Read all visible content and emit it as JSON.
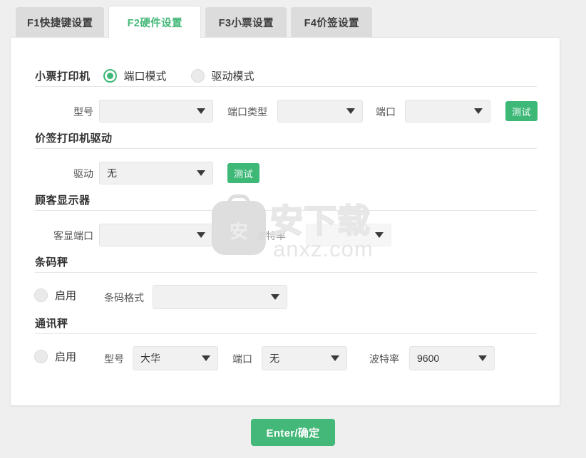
{
  "tabs": [
    {
      "label": "F1快捷键设置",
      "active": false
    },
    {
      "label": "F2硬件设置",
      "active": true
    },
    {
      "label": "F3小票设置",
      "active": false
    },
    {
      "label": "F4价签设置",
      "active": false
    }
  ],
  "colors": {
    "accent_green": "#3db877",
    "button_green": "#44b878",
    "page_background": "#efefef",
    "panel_background": "#ffffff",
    "field_background": "#f1f1f1",
    "tab_inactive": "#dcdcdc"
  },
  "sections": {
    "receipt_printer": {
      "title": "小票打印机",
      "mode_port": {
        "label": "端口模式",
        "selected": true
      },
      "mode_driver": {
        "label": "驱动模式",
        "selected": false
      },
      "model_label": "型号",
      "model_value": "",
      "port_type_label": "端口类型",
      "port_type_value": "",
      "port_label": "端口",
      "port_value": "",
      "test_label": "测试"
    },
    "tag_printer": {
      "title": "价签打印机驱动",
      "driver_label": "驱动",
      "driver_value": "无",
      "test_label": "测试"
    },
    "customer_display": {
      "title": "顾客显示器",
      "port_label": "客显端口",
      "port_value": "",
      "baud_label": "波特率",
      "baud_value": ""
    },
    "barcode_scale": {
      "title": "条码秤",
      "enable_label": "启用",
      "enabled": false,
      "format_label": "条码格式",
      "format_value": ""
    },
    "comm_scale": {
      "title": "通讯秤",
      "enable_label": "启用",
      "enabled": false,
      "model_label": "型号",
      "model_value": "大华",
      "port_label": "端口",
      "port_value": "无",
      "baud_label": "波特率",
      "baud_value": "9600"
    }
  },
  "footer": {
    "confirm_label": "Enter/确定"
  },
  "watermark": {
    "text_cn": "安下载",
    "text_url": "anxz.com",
    "badge_char": "安"
  }
}
